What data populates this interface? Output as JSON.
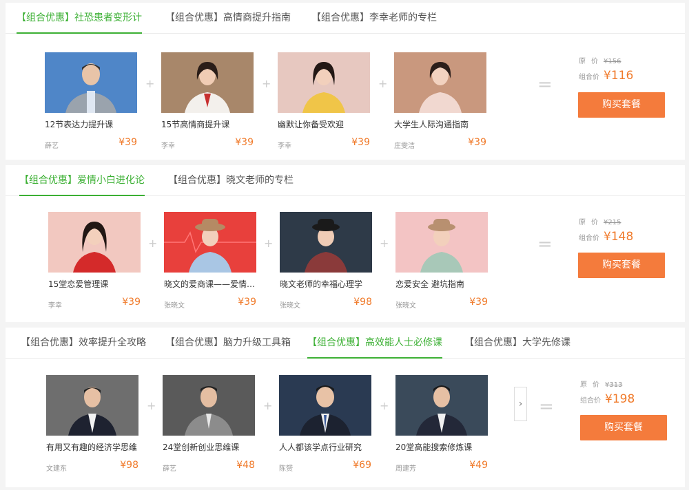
{
  "sections": [
    {
      "tabs": [
        "【组合优惠】社恐患者变形计",
        "【组合优惠】高情商提升指南",
        "【组合优惠】李幸老师的专栏"
      ],
      "active_tab": 0,
      "courses": [
        {
          "title": "12节表达力提升课",
          "author": "薛艺",
          "price": "¥39"
        },
        {
          "title": "15节高情商提升课",
          "author": "李幸",
          "price": "¥39"
        },
        {
          "title": "幽默让你备受欢迎",
          "author": "李幸",
          "price": "¥39"
        },
        {
          "title": "大学生人际沟通指南",
          "author": "庄雯洁",
          "price": "¥39"
        }
      ],
      "original_label": "原价",
      "original_price": "¥156",
      "combo_label": "组合价",
      "combo_price": "¥116",
      "buy_label": "购买套餐"
    },
    {
      "tabs": [
        "【组合优惠】爱情小白进化论",
        "【组合优惠】晓文老师的专栏"
      ],
      "active_tab": 0,
      "courses": [
        {
          "title": "15堂恋爱管理课",
          "author": "李幸",
          "price": "¥39"
        },
        {
          "title": "晓文的爱商课——爱情…",
          "author": "张晓文",
          "price": "¥39"
        },
        {
          "title": "晓文老师的幸福心理学",
          "author": "张晓文",
          "price": "¥98"
        },
        {
          "title": "恋爱安全 避坑指南",
          "author": "张晓文",
          "price": "¥39"
        }
      ],
      "original_label": "原价",
      "original_price": "¥215",
      "combo_label": "组合价",
      "combo_price": "¥148",
      "buy_label": "购买套餐"
    },
    {
      "tabs": [
        "【组合优惠】效率提升全攻略",
        "【组合优惠】脑力升级工具箱",
        "【组合优惠】高效能人士必修课",
        "【组合优惠】大学先修课"
      ],
      "active_tab": 2,
      "courses": [
        {
          "title": "有用又有趣的经济学思维",
          "author": "文建东",
          "price": "¥98"
        },
        {
          "title": "24堂创新创业思维课",
          "author": "薛艺",
          "price": "¥48"
        },
        {
          "title": "人人都该学点行业研究",
          "author": "陈赟",
          "price": "¥69"
        },
        {
          "title": "20堂高能搜索修炼课",
          "author": "周建芳",
          "price": "¥49"
        }
      ],
      "original_label": "原价",
      "original_price": "¥313",
      "combo_label": "组合价",
      "combo_price": "¥198",
      "buy_label": "购买套餐",
      "arrow_icon": "chevron-right-icon"
    }
  ],
  "colors": {
    "accent_green": "#3cb034",
    "price_orange": "#f07a2a",
    "button_orange": "#f47b3c"
  }
}
